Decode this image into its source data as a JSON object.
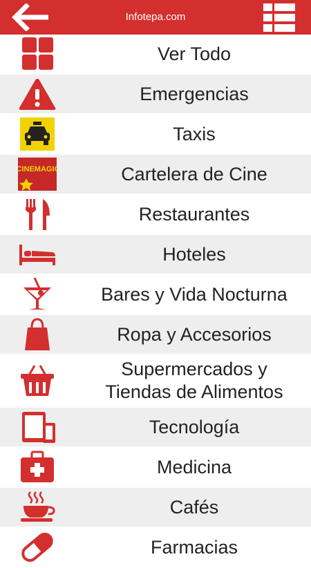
{
  "header": {
    "title": "Infotepa.com",
    "back_icon": "arrow-left-icon",
    "menu_icon": "list-menu-icon",
    "accent_color": "#d32f2f"
  },
  "categories": [
    {
      "label": "Ver Todo",
      "icon": "grid-icon"
    },
    {
      "label": "Emergencias",
      "icon": "warning-icon"
    },
    {
      "label": "Taxis",
      "icon": "taxi-icon"
    },
    {
      "label": "Cartelera de Cine",
      "icon": "cinemagic-logo-icon",
      "logo_text": "CINEMAGIC"
    },
    {
      "label": "Restaurantes",
      "icon": "fork-knife-icon"
    },
    {
      "label": "Hoteles",
      "icon": "bed-icon"
    },
    {
      "label": "Bares y Vida Nocturna",
      "icon": "cocktail-icon"
    },
    {
      "label": "Ropa y Accesorios",
      "icon": "shopping-bag-icon"
    },
    {
      "label": "Supermercados y\nTiendas de Alimentos",
      "icon": "basket-icon"
    },
    {
      "label": "Tecnología",
      "icon": "devices-icon"
    },
    {
      "label": "Medicina",
      "icon": "medical-kit-icon"
    },
    {
      "label": "Cafés",
      "icon": "coffee-cup-icon"
    },
    {
      "label": "Farmacias",
      "icon": "pill-icon"
    }
  ]
}
